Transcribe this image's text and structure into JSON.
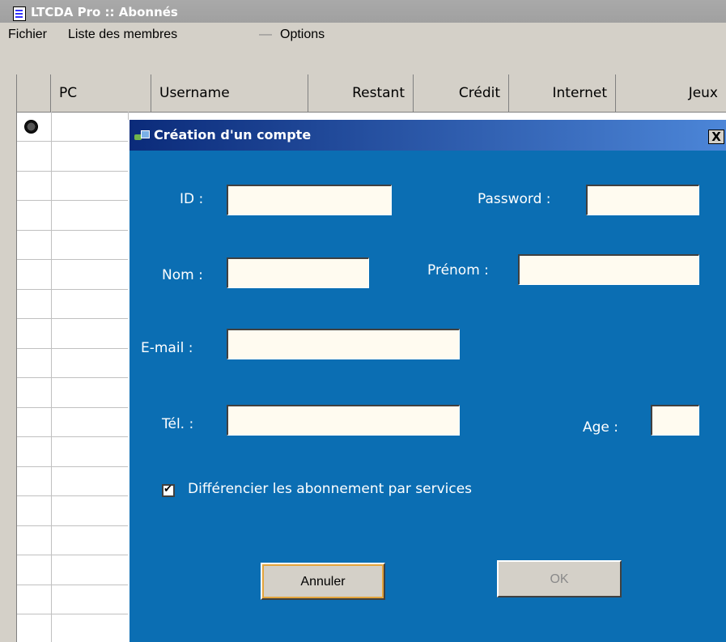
{
  "window": {
    "title": "LTCDA Pro :: Abonnés"
  },
  "menu": {
    "items": [
      "Fichier",
      "Liste des membres",
      "—",
      "Options"
    ]
  },
  "table": {
    "columns": [
      "PC",
      "Username",
      "Restant",
      "Crédit",
      "Internet",
      "Jeux"
    ]
  },
  "dialog": {
    "title": "Création d'un compte",
    "close_label": "X",
    "fields": {
      "id_label": "ID :",
      "password_label": "Password :",
      "nom_label": "Nom :",
      "prenom_label": "Prénom :",
      "email_label": "E-mail :",
      "tel_label": "Tél. :",
      "age_label": "Age :"
    },
    "checkbox": {
      "label": "Différencier les abonnement par services",
      "checked": true
    },
    "buttons": {
      "cancel_label": "Annuler",
      "ok_label": "OK"
    }
  }
}
